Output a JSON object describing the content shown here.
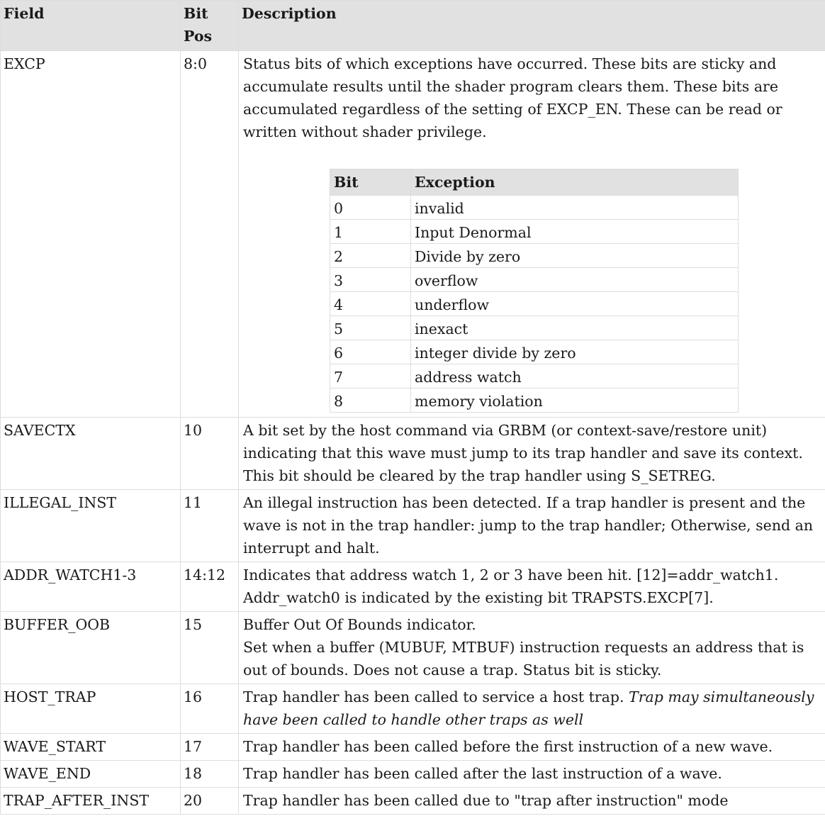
{
  "headers": {
    "field": "Field",
    "bitpos": "Bit Pos",
    "description": "Description"
  },
  "excp": {
    "field": "EXCP",
    "bitpos": "8:0",
    "description": "Status bits of which exceptions have occurred. These bits are sticky and accumulate results until the shader program clears them. These bits are accumulated regardless of the setting of EXCP_EN. These can be read or written without shader privilege.",
    "subtable": {
      "headers": {
        "bit": "Bit",
        "exception": "Exception"
      },
      "rows": [
        {
          "bit": "0",
          "exception": "invalid"
        },
        {
          "bit": "1",
          "exception": "Input Denormal"
        },
        {
          "bit": "2",
          "exception": "Divide by zero"
        },
        {
          "bit": "3",
          "exception": "overflow"
        },
        {
          "bit": "4",
          "exception": "underflow"
        },
        {
          "bit": "5",
          "exception": "inexact"
        },
        {
          "bit": "6",
          "exception": "integer divide by zero"
        },
        {
          "bit": "7",
          "exception": "address watch"
        },
        {
          "bit": "8",
          "exception": "memory violation"
        }
      ]
    }
  },
  "rows": [
    {
      "field": "SAVECTX",
      "bitpos": "10",
      "description": "A bit set by the host command via GRBM (or context-save/restore unit) indicating that this wave must jump to its trap handler and save its context. This bit should be cleared by the trap handler using S_SETREG."
    },
    {
      "field": "ILLEGAL_INST",
      "bitpos": "11",
      "description": "An illegal instruction has been detected. If a trap handler is present and the wave is not in the trap handler: jump to the trap handler; Otherwise, send an interrupt and halt."
    },
    {
      "field": "ADDR_WATCH1-3",
      "bitpos": "14:12",
      "description": "Indicates that address watch 1, 2 or 3 have been hit. [12]=addr_watch1. Addr_watch0 is indicated by the existing bit TRAPSTS.EXCP[7]."
    },
    {
      "field": "BUFFER_OOB",
      "bitpos": "15",
      "description": "Buffer Out Of Bounds indicator.",
      "description2": "Set when a buffer (MUBUF, MTBUF) instruction requests an address that is out of bounds. Does not cause a trap. Status bit is sticky."
    },
    {
      "field": "HOST_TRAP",
      "bitpos": "16",
      "description": "Trap handler has been called to service a host trap.",
      "description_italic": "Trap may simultaneously have been called to handle other traps as well"
    },
    {
      "field": "WAVE_START",
      "bitpos": "17",
      "description": "Trap handler has been called before the first instruction of a new wave."
    },
    {
      "field": "WAVE_END",
      "bitpos": "18",
      "description": "Trap handler has been called after the last instruction of a wave."
    },
    {
      "field": "TRAP_AFTER_INST",
      "bitpos": "20",
      "description": "Trap handler has been called due to \"trap after instruction\" mode"
    }
  ]
}
